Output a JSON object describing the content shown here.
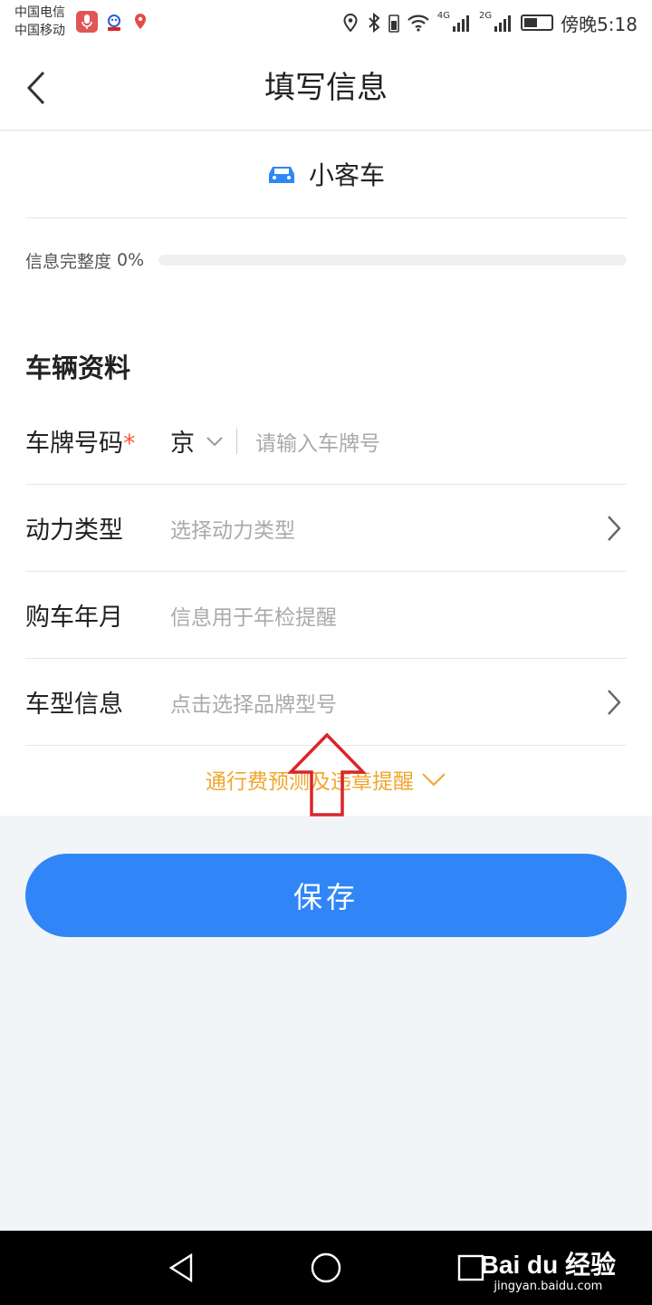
{
  "status_bar": {
    "carrier_1": "中国电信",
    "carrier_2": "中国移动",
    "network_1": "4G",
    "network_2": "2G",
    "time": "傍晚5:18"
  },
  "header": {
    "title": "填写信息",
    "back_icon": "chevron-left-icon"
  },
  "vehicle": {
    "type_label": "小客车",
    "icon": "car-icon",
    "icon_color": "#2f87f5"
  },
  "progress": {
    "label": "信息完整度",
    "percent_text": "0%",
    "value": 0
  },
  "section": {
    "title": "车辆资料"
  },
  "form": {
    "plate": {
      "label": "车牌号码",
      "required_mark": "*",
      "province": "京",
      "placeholder": "请输入车牌号"
    },
    "power_type": {
      "label": "动力类型",
      "placeholder": "选择动力类型"
    },
    "purchase_date": {
      "label": "购车年月",
      "placeholder": "信息用于年检提醒"
    },
    "model": {
      "label": "车型信息",
      "placeholder": "点击选择品牌型号"
    }
  },
  "more": {
    "label": "通行费预测及违章提醒"
  },
  "actions": {
    "save_label": "保存"
  },
  "watermark": {
    "logo": "Bai du 经验",
    "url": "jingyan.baidu.com"
  },
  "colors": {
    "accent": "#3086f6",
    "warning": "#f0a62e",
    "required": "#ff5a3c",
    "annotation": "#d9252a"
  }
}
